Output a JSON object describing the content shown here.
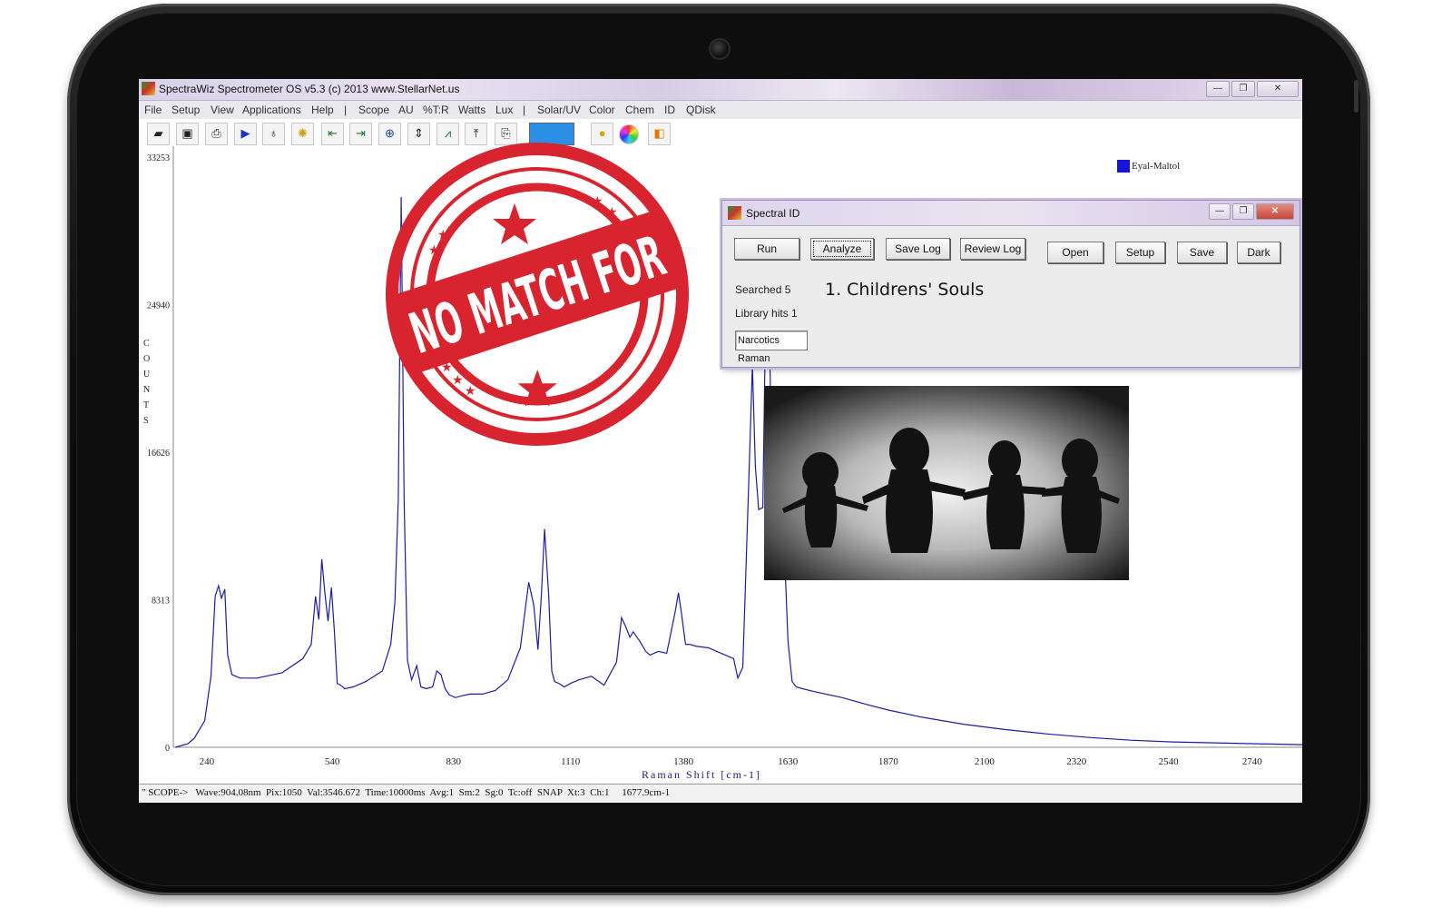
{
  "window": {
    "title": "SpectraWiz  Spectrometer OS v5.3 (c) 2013    www.StellarNet.us",
    "minimize": "—",
    "maximize": "❐",
    "close": "✕"
  },
  "menu": [
    "File",
    "Setup",
    "View",
    "Applications",
    "Help",
    "|",
    "Scope",
    "AU",
    "%T:R",
    "Watts",
    "Lux",
    "|",
    "Solar/UV",
    "Color",
    "Chem",
    "ID",
    "QDisk"
  ],
  "toolbar": {
    "icons": [
      "open-icon",
      "save-disk-icon",
      "print-icon",
      "play-icon",
      "probe-icon",
      "bulb-icon",
      "left-cursor-icon",
      "right-cursor-icon",
      "zoom-icon",
      "autoscale-icon",
      "peaks-icon",
      "upload-icon",
      "clipboard-icon",
      "color-swatch",
      "yellow-dot-icon",
      "color-wheel-icon",
      "chart-icon"
    ]
  },
  "legend": {
    "label": "Eyal-Maltol",
    "color": "#1515d6"
  },
  "chart_data": {
    "type": "line",
    "xlabel": "Raman Shift [cm-1]",
    "ylabel": "COUNTS",
    "xticks": [
      240,
      540,
      830,
      1110,
      1380,
      1630,
      1870,
      2100,
      2320,
      2540,
      2740
    ],
    "yticks": [
      0,
      8313,
      16626,
      24940,
      33253
    ],
    "xlim": [
      160,
      2860
    ],
    "ylim": [
      0,
      33253
    ],
    "series": [
      {
        "name": "Eyal-Maltol",
        "color": "#1c1ca6",
        "x": [
          165,
          195,
          210,
          235,
          250,
          260,
          268,
          275,
          283,
          290,
          300,
          320,
          360,
          420,
          470,
          490,
          500,
          508,
          515,
          523,
          530,
          538,
          545,
          552,
          560,
          570,
          590,
          620,
          660,
          680,
          690,
          698,
          705,
          712,
          720,
          730,
          742,
          752,
          765,
          780,
          790,
          800,
          810,
          820,
          835,
          850,
          870,
          900,
          930,
          960,
          990,
          1010,
          1022,
          1032,
          1040,
          1048,
          1058,
          1065,
          1072,
          1082,
          1095,
          1110,
          1130,
          1160,
          1190,
          1220,
          1232,
          1242,
          1252,
          1260,
          1275,
          1290,
          1300,
          1320,
          1340,
          1360,
          1368,
          1375,
          1385,
          1395,
          1410,
          1440,
          1470,
          1500,
          1510,
          1522,
          1535,
          1545,
          1552,
          1560,
          1570,
          1575,
          1582,
          1590,
          1598,
          1605,
          1612,
          1620,
          1630,
          1640,
          1650,
          1665,
          1700,
          1760,
          1820,
          1870,
          1950,
          2050,
          2150,
          2250,
          2350,
          2450,
          2550,
          2650,
          2750,
          2860
        ],
        "y": [
          0,
          200,
          500,
          1500,
          4000,
          8500,
          9100,
          8400,
          8900,
          5200,
          4100,
          3900,
          3900,
          4200,
          5000,
          5800,
          8500,
          7200,
          10600,
          8600,
          7100,
          9000,
          6600,
          3600,
          3500,
          3300,
          3400,
          3700,
          4300,
          5800,
          8200,
          14000,
          31000,
          14000,
          4900,
          3800,
          4600,
          3400,
          3300,
          3400,
          4300,
          4100,
          3300,
          2950,
          2800,
          2900,
          3000,
          3000,
          3200,
          3800,
          5600,
          9300,
          8000,
          5500,
          8500,
          12300,
          8500,
          4300,
          3700,
          3600,
          3400,
          3600,
          3800,
          4000,
          3500,
          4800,
          7300,
          6800,
          6200,
          6500,
          6000,
          5400,
          5200,
          5400,
          5300,
          7600,
          8700,
          7600,
          5800,
          5800,
          5700,
          5600,
          5300,
          5000,
          3900,
          4500,
          14000,
          21500,
          15800,
          13400,
          13500,
          21600,
          29000,
          17000,
          12700,
          13500,
          16000,
          12000,
          6000,
          3700,
          3400,
          3300,
          3100,
          2800,
          2400,
          2100,
          1700,
          1300,
          1000,
          750,
          550,
          400,
          300,
          250,
          200,
          150
        ]
      }
    ]
  },
  "status": {
    "text": "\" SCOPE->   Wave:904.08nm  Pix:1050  Val:3546.672  Time:10000ms  Avg:1  Sm:2  Sg:0  Tc:off  SNAP  Xt:3  Ch:1     1677.9cm-1"
  },
  "dialog": {
    "title": "Spectral ID",
    "buttons": [
      "Run",
      "Analyze",
      "Save Log",
      "Review Log",
      "Open",
      "Setup",
      "Save",
      "Dark"
    ],
    "searched_label": "Searched  5",
    "hits_label": "Library hits  1",
    "library": "Narcotics Raman",
    "result": "1. Childrens' Souls"
  },
  "stamp": {
    "text": "NO MATCH FOR",
    "color": "#d8242e"
  },
  "photo": {
    "description_icon": "children-silhouettes"
  }
}
